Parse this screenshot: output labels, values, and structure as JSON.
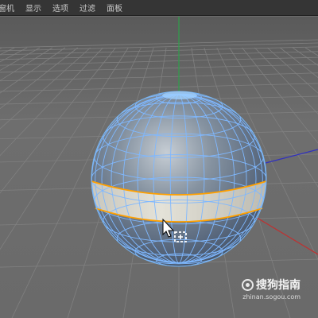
{
  "menubar": {
    "items": [
      "窗机",
      "显示",
      "选项",
      "过滤",
      "面板"
    ]
  },
  "viewport": {
    "background": "#6b6b6b",
    "grid_color": "#808080",
    "axis_colors": {
      "x": "#c03030",
      "y": "#2ea04a",
      "z": "#3030c0"
    },
    "sphere_color": "#5f6f82",
    "wireframe_color": "#7fb8ff",
    "selected_band_fill": "#d8d6cc",
    "selection_outline_color": "#ffa000"
  },
  "watermark": {
    "brand": "搜狗指南",
    "url": "zhinan.sogou.com"
  },
  "cursor": {
    "icon": "arrow-cursor-icon",
    "tool_icon": "move-tool-icon"
  }
}
